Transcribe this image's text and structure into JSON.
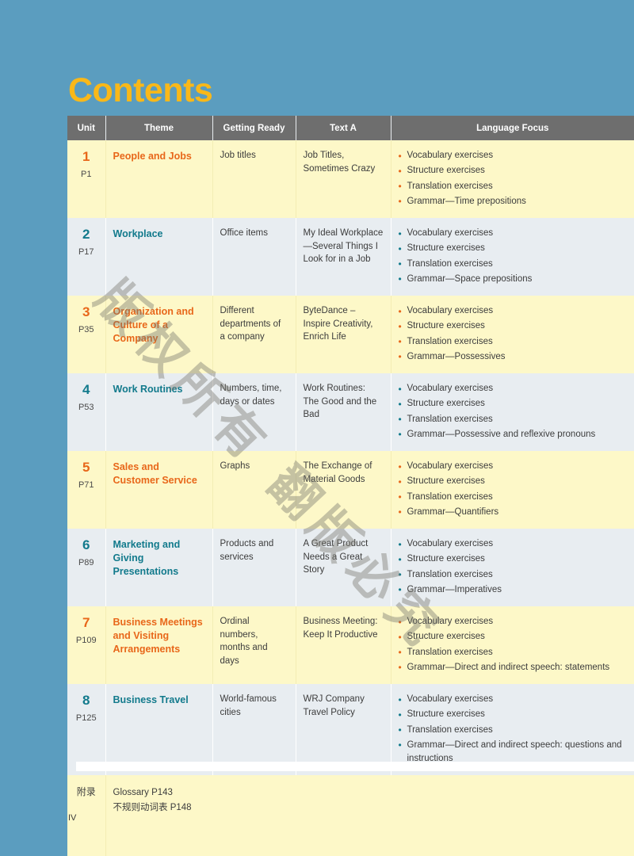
{
  "page": {
    "title": "Contents",
    "folio": "IV",
    "background_color": "#5b9dbf",
    "title_color": "#f9b819"
  },
  "watermark": {
    "text": "版权所有 翻版必究"
  },
  "table": {
    "headers": [
      {
        "key": "unit",
        "label": "Unit"
      },
      {
        "key": "theme",
        "label": "Theme"
      },
      {
        "key": "getting_ready",
        "label": "Getting Ready"
      },
      {
        "key": "text_a",
        "label": "Text A"
      },
      {
        "key": "language_focus",
        "label": "Language Focus"
      }
    ],
    "header_bg": "#6e6e6e",
    "row_colors": {
      "odd": "#fdf8c8",
      "even": "#e8edf1"
    },
    "accent_colors": {
      "orange": "#e8671a",
      "teal": "#127a8c"
    },
    "rows": [
      {
        "unit": "1",
        "page": "P1",
        "theme": "People and Jobs",
        "getting_ready": "Job titles",
        "text_a": "Job Titles, Sometimes Crazy",
        "language_focus": [
          "Vocabulary exercises",
          "Structure exercises",
          "Translation exercises",
          "Grammar—Time prepositions"
        ]
      },
      {
        "unit": "2",
        "page": "P17",
        "theme": "Workplace",
        "getting_ready": "Office items",
        "text_a": "My Ideal Workplace—Several Things I Look for in a Job",
        "language_focus": [
          "Vocabulary exercises",
          "Structure exercises",
          "Translation exercises",
          "Grammar—Space prepositions"
        ]
      },
      {
        "unit": "3",
        "page": "P35",
        "theme": "Organization and Culture of a Company",
        "getting_ready": "Different departments of a company",
        "text_a": "ByteDance – Inspire Creativity, Enrich Life",
        "language_focus": [
          "Vocabulary exercises",
          "Structure exercises",
          "Translation exercises",
          "Grammar—Possessives"
        ]
      },
      {
        "unit": "4",
        "page": "P53",
        "theme": "Work Routines",
        "getting_ready": "Numbers, time, days or dates",
        "text_a": "Work Routines: The Good and the Bad",
        "language_focus": [
          "Vocabulary exercises",
          "Structure exercises",
          "Translation exercises",
          "Grammar—Possessive and reflexive pronouns"
        ]
      },
      {
        "unit": "5",
        "page": "P71",
        "theme": "Sales and Customer Service",
        "getting_ready": "Graphs",
        "text_a": "The Exchange of Material Goods",
        "language_focus": [
          "Vocabulary exercises",
          "Structure exercises",
          "Translation exercises",
          "Grammar—Quantifiers"
        ]
      },
      {
        "unit": "6",
        "page": "P89",
        "theme": "Marketing and Giving Presentations",
        "getting_ready": "Products and services",
        "text_a": "A Great Product Needs a Great Story",
        "language_focus": [
          "Vocabulary exercises",
          "Structure exercises",
          "Translation exercises",
          "Grammar—Imperatives"
        ]
      },
      {
        "unit": "7",
        "page": "P109",
        "theme": "Business Meetings and Visiting Arrangements",
        "getting_ready": "Ordinal numbers, months and days",
        "text_a": "Business Meeting: Keep It Productive",
        "language_focus": [
          "Vocabulary exercises",
          "Structure exercises",
          "Translation exercises",
          "Grammar—Direct and indirect speech: statements"
        ]
      },
      {
        "unit": "8",
        "page": "P125",
        "theme": "Business Travel",
        "getting_ready": "World-famous cities",
        "text_a": "WRJ Company Travel Policy",
        "language_focus": [
          "Vocabulary exercises",
          "Structure exercises",
          "Translation exercises",
          "Grammar—Direct and indirect speech: questions and instructions"
        ]
      }
    ],
    "appendix": {
      "label": "附录",
      "lines": [
        "Glossary P143",
        "不规则动词表 P148"
      ]
    }
  }
}
